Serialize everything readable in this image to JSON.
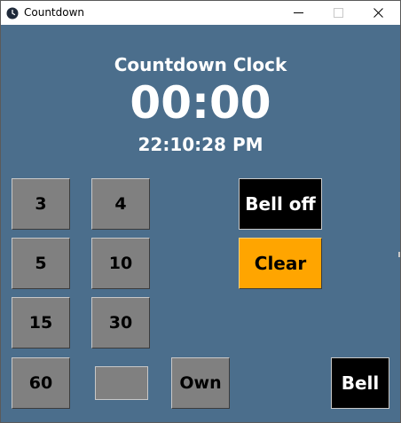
{
  "window": {
    "title": "Countdown"
  },
  "clock": {
    "heading": "Countdown Clock",
    "remaining": "00:00",
    "current_time": "22:10:28 PM"
  },
  "presets": [
    "3",
    "4",
    "5",
    "10",
    "15",
    "30",
    "60"
  ],
  "controls": {
    "bell_off_label": "Bell off",
    "clear_label": "Clear",
    "own_label": "Own",
    "bell_label": "Bell",
    "own_minutes_value": ""
  },
  "colors": {
    "background": "#4b6e8c",
    "button_gray": "#808080",
    "bell_button": "#000000",
    "clear_button": "#ffa500",
    "text_light": "#ffffff"
  },
  "icons": {
    "app": "clock-icon",
    "minimize": "minimize-icon",
    "maximize": "maximize-icon",
    "close": "close-icon"
  }
}
